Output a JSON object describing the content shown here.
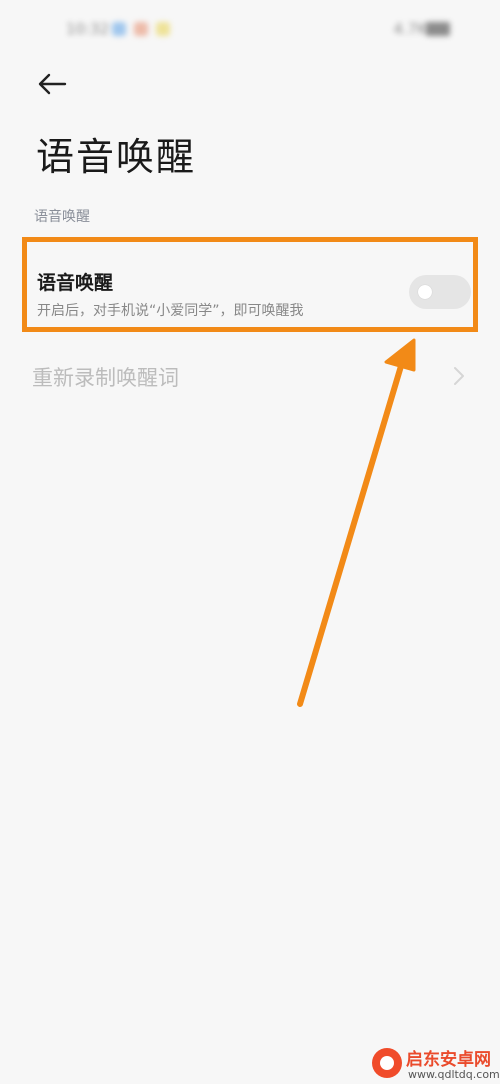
{
  "status_bar": {
    "time": "10:32",
    "right_text": "4.7K/s"
  },
  "header": {
    "back_icon": "back-arrow-icon",
    "title": "语音唤醒"
  },
  "section": {
    "header": "语音唤醒"
  },
  "voice_wakeup_row": {
    "title": "语音唤醒",
    "subtitle": "开启后，对手机说“小爱同学”，即可唤醒我",
    "toggle_on": false,
    "highlight_color": "#f28a17"
  },
  "rerecord_row": {
    "label": "重新录制唤醒词",
    "chevron_icon": "chevron-right-icon"
  },
  "annotation": {
    "arrow_color": "#f28a17"
  },
  "watermark": {
    "name": "启东安卓网",
    "url": "www.qdltdq.com"
  }
}
